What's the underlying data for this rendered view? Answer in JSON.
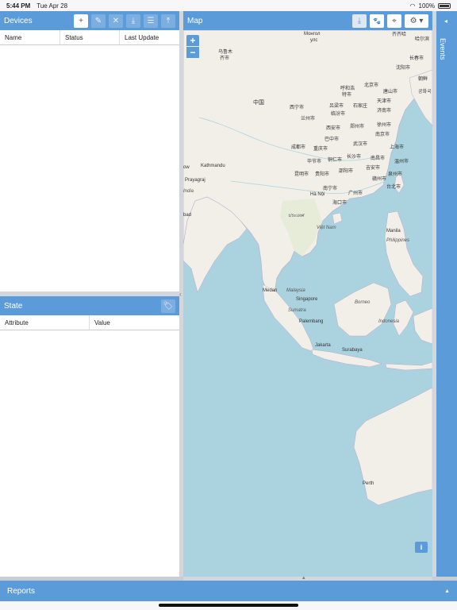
{
  "statusbar": {
    "time": "5:44 PM",
    "date": "Tue Apr 28",
    "battery": "100%"
  },
  "devices": {
    "title": "Devices",
    "toolbar": [
      {
        "icon": "plus-icon",
        "glyph": "+"
      },
      {
        "icon": "pencil-icon",
        "glyph": "✎"
      },
      {
        "icon": "close-icon",
        "glyph": "✕"
      },
      {
        "icon": "download-icon",
        "glyph": "⤓"
      },
      {
        "icon": "list-icon",
        "glyph": "☰"
      },
      {
        "icon": "upload-icon",
        "glyph": "⤒"
      }
    ],
    "columns": [
      "Name",
      "Status",
      "Last Update"
    ]
  },
  "state": {
    "title": "State",
    "tag_icon": "tag-icon",
    "columns": [
      "Attribute",
      "Value"
    ]
  },
  "map": {
    "title": "Map",
    "toolbar": [
      {
        "icon": "download-icon",
        "glyph": "⤓"
      },
      {
        "icon": "paw-icon",
        "glyph": "🐾"
      },
      {
        "icon": "crosshair-icon",
        "glyph": "⌖"
      },
      {
        "icon": "gear-icon",
        "glyph": "⚙ ▾"
      }
    ],
    "zoom_in": "+",
    "zoom_out": "−",
    "info": "i",
    "labels": {
      "l1": "齐齐哈",
      "l2": "哈尔滨",
      "l3": "长春市",
      "l4": "沈阳市",
      "l5": "Монгол",
      "l6": "улс",
      "l7": "乌鲁木",
      "l8": "齐市",
      "l9": "呼和浩",
      "l10": "特市",
      "l11": "北京市",
      "l12": "唐山市",
      "l13": "天津市",
      "l14": "中国",
      "l15": "西宁市",
      "l16": "兰州市",
      "l17": "呂梁市",
      "l18": "临汾市",
      "l19": "石家庄",
      "l20": "济南市",
      "l21": "西安市",
      "l22": "郑州市",
      "l23": "徐州市",
      "l24": "南京市",
      "l25": "上海市",
      "l26": "武汉市",
      "l27": "巴中市",
      "l28": "成都市",
      "l29": "重庆市",
      "l30": "长沙市",
      "l31": "南昌市",
      "l32": "温州市",
      "l33": "毕节市",
      "l34": "铜仁市",
      "l35": "吉安市",
      "l36": "Kathmandu",
      "l37": "昆明市",
      "l38": "贵阳市",
      "l39": "邵阳市",
      "l40": "泉州市",
      "l41": "Prayagraj",
      "l42": "台北市",
      "l43": "广州市",
      "l44": "南宁市",
      "l45": "Hà Nội",
      "l46": "海口市",
      "l47": "Việt Nam",
      "l48": "Manila",
      "l49": "Philippines",
      "l50": "Medan",
      "l51": "Malaysia",
      "l52": "Singapore",
      "l53": "Sumatra",
      "l54": "Borneo",
      "l55": "Palembang",
      "l56": "Indonesia",
      "l57": "Jakarta",
      "l58": "Surabaya",
      "l59": "Perth",
      "l60": "India",
      "l61": "bad",
      "l62": "ow",
      "l63": "朝鲜",
      "l64": "공화국",
      "l65": "赣州市",
      "l66": "ประเทศ"
    }
  },
  "events": {
    "title": "Events"
  },
  "reports": {
    "title": "Reports"
  }
}
